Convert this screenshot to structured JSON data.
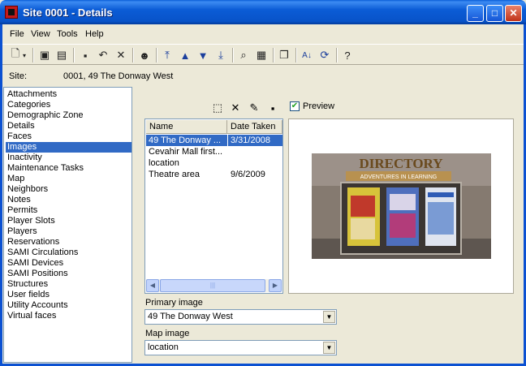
{
  "window": {
    "title": "Site 0001 - Details",
    "buttons": {
      "minimize": "_",
      "maximize": "□",
      "close": "✕"
    }
  },
  "menu": [
    {
      "label": "File"
    },
    {
      "label": "View"
    },
    {
      "label": "Tools"
    },
    {
      "label": "Help"
    }
  ],
  "toolbar": {
    "icons": [
      "new-page-icon",
      "dropdown-arrow-icon",
      "save-copy-icon",
      "save-new-icon",
      "save-icon",
      "undo-icon",
      "delete-icon",
      "person-location-icon",
      "move-first-icon",
      "move-up-icon",
      "move-down-icon",
      "move-last-icon",
      "search-icon",
      "report-icon",
      "copy-icon",
      "sort-az-icon",
      "refresh-icon",
      "help-icon"
    ]
  },
  "site": {
    "label": "Site:",
    "value": "0001, 49 The Donway West"
  },
  "categories": [
    "Attachments",
    "Categories",
    "Demographic Zone",
    "Details",
    "Faces",
    "Images",
    "Inactivity",
    "Maintenance Tasks",
    "Map",
    "Neighbors",
    "Notes",
    "Permits",
    "Player Slots",
    "Players",
    "Reservations",
    "SAMI Circulations",
    "SAMI Devices",
    "SAMI Positions",
    "Structures",
    "User fields",
    "Utility Accounts",
    "Virtual faces"
  ],
  "selected_category": "Images",
  "images_panel": {
    "preview_label": "Preview",
    "preview_checked": true,
    "columns": {
      "name": "Name",
      "date": "Date Taken"
    },
    "rows": [
      {
        "name": "49 The Donway ...",
        "date": "3/31/2008",
        "selected": true
      },
      {
        "name": "Cevahir Mall first...",
        "date": ""
      },
      {
        "name": "location",
        "date": ""
      },
      {
        "name": "Theatre area",
        "date": "9/6/2009"
      }
    ],
    "photo_sign": "DIRECTORY",
    "photo_banner": "ADVENTURES IN LEARNING"
  },
  "primary_image": {
    "label": "Primary image",
    "value": "49 The Donway West"
  },
  "map_image": {
    "label": "Map image",
    "value": "location"
  },
  "colors": {
    "selection": "#316ac5",
    "titlebar": "#0b5cd6",
    "face": "#ece9d8"
  }
}
